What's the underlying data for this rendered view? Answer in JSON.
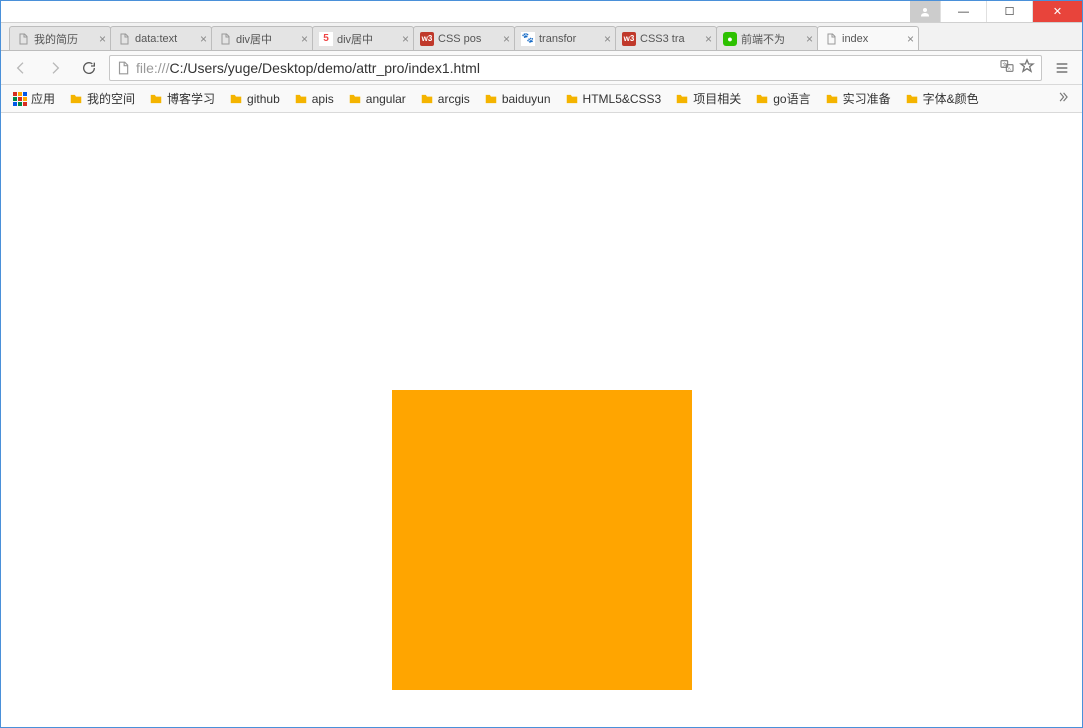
{
  "window_controls": {
    "minimize": "—",
    "maximize": "☐",
    "close": "✕"
  },
  "tabs": [
    {
      "title": "我的简历",
      "icon": "doc"
    },
    {
      "title": "data:text",
      "icon": "doc"
    },
    {
      "title": "div居中",
      "icon": "doc"
    },
    {
      "title": "div居中",
      "icon": "5"
    },
    {
      "title": "CSS pos",
      "icon": "w3"
    },
    {
      "title": "transfor",
      "icon": "baidu"
    },
    {
      "title": "CSS3 tra",
      "icon": "w3"
    },
    {
      "title": "前端不为",
      "icon": "wx"
    },
    {
      "title": "index",
      "icon": "doc",
      "active": true
    }
  ],
  "address": {
    "protocol": "file:///",
    "path": "C:/Users/yuge/Desktop/demo/attr_pro/index1.html"
  },
  "bookmarks": {
    "apps_label": "应用",
    "folders": [
      "我的空间",
      "博客学习",
      "github",
      "apis",
      "angular",
      "arcgis",
      "baiduyun",
      "HTML5&CSS3",
      "项目相关",
      "go语言",
      "实习准备",
      "字体&颜色"
    ]
  },
  "content": {
    "square_color": "#ffa500"
  }
}
